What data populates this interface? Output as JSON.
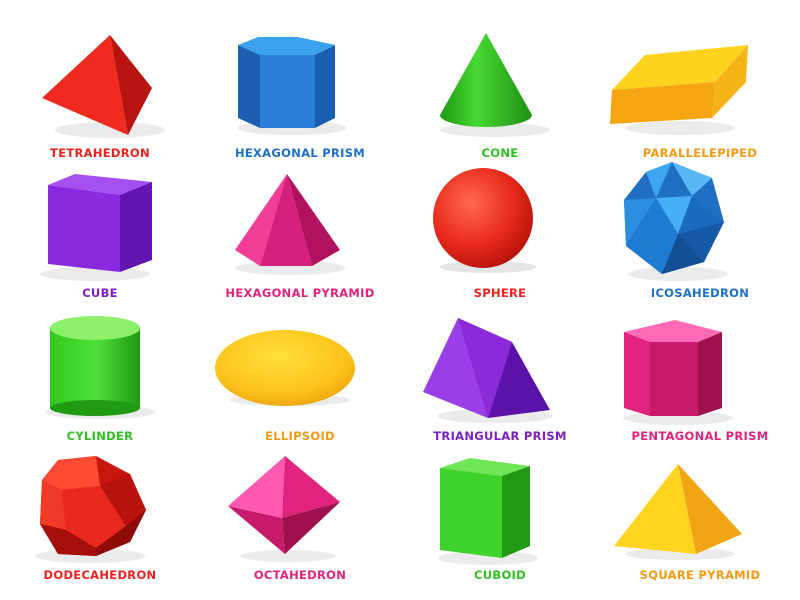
{
  "shapes": [
    {
      "label": "TETRAHEDRON",
      "color": "#e8231f"
    },
    {
      "label": "HEXAGONAL PRISM",
      "color": "#1e6fc4"
    },
    {
      "label": "CONE",
      "color": "#2fbf1f"
    },
    {
      "label": "PARALLELEPIPED",
      "color": "#f29a12"
    },
    {
      "label": "CUBE",
      "color": "#7b1fc8"
    },
    {
      "label": "HEXAGONAL PYRAMID",
      "color": "#e0237d"
    },
    {
      "label": "SPHERE",
      "color": "#e8231f"
    },
    {
      "label": "ICOSAHEDRON",
      "color": "#1e6fc4"
    },
    {
      "label": "CYLINDER",
      "color": "#2fbf1f"
    },
    {
      "label": "ELLIPSOID",
      "color": "#f29a12"
    },
    {
      "label": "TRIANGULAR PRISM",
      "color": "#7b1fc8"
    },
    {
      "label": "PENTAGONAL PRISM",
      "color": "#e0237d"
    },
    {
      "label": "DODECAHEDRON",
      "color": "#e8231f"
    },
    {
      "label": "OCTAHEDRON",
      "color": "#e0237d"
    },
    {
      "label": "CUBOID",
      "color": "#2fbf1f"
    },
    {
      "label": "SQUARE PYRAMID",
      "color": "#f29a12"
    }
  ]
}
